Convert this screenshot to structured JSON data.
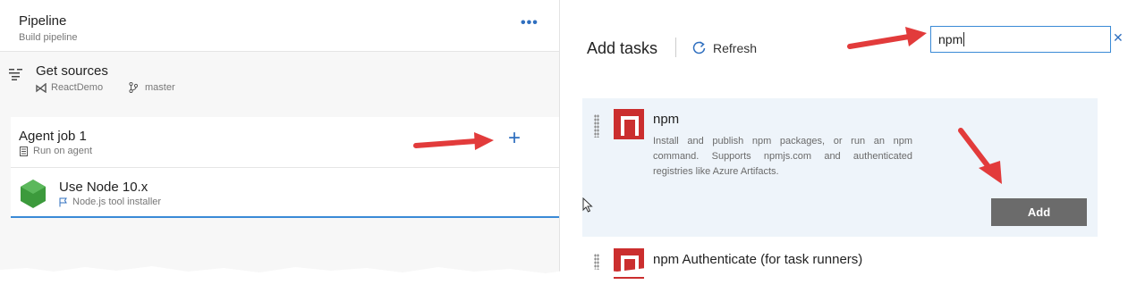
{
  "pipeline": {
    "title": "Pipeline",
    "subtitle": "Build pipeline",
    "more_label": "•••"
  },
  "get_sources": {
    "title": "Get sources",
    "repo": "ReactDemo",
    "branch": "master"
  },
  "agent_job": {
    "title": "Agent job 1",
    "subtitle": "Run on agent",
    "add_label": "+"
  },
  "node_task": {
    "title": "Use Node 10.x",
    "subtitle": "Node.js tool installer"
  },
  "add_tasks": {
    "title": "Add tasks",
    "refresh_label": "Refresh",
    "search_value": "npm",
    "clear_label": "✕"
  },
  "tasks": [
    {
      "name": "npm",
      "description": "Install and publish npm packages, or run an npm command. Supports npmjs.com and authenticated registries like Azure Artifacts.",
      "add_label": "Add"
    },
    {
      "name": "npm Authenticate (for task runners)"
    }
  ],
  "colors": {
    "accent": "#2f6fbf",
    "arrow": "#e23b3b",
    "task_icon": "#cb2e2e",
    "add_button": "#6b6b6b",
    "node_icon": "#3c9a3c"
  }
}
